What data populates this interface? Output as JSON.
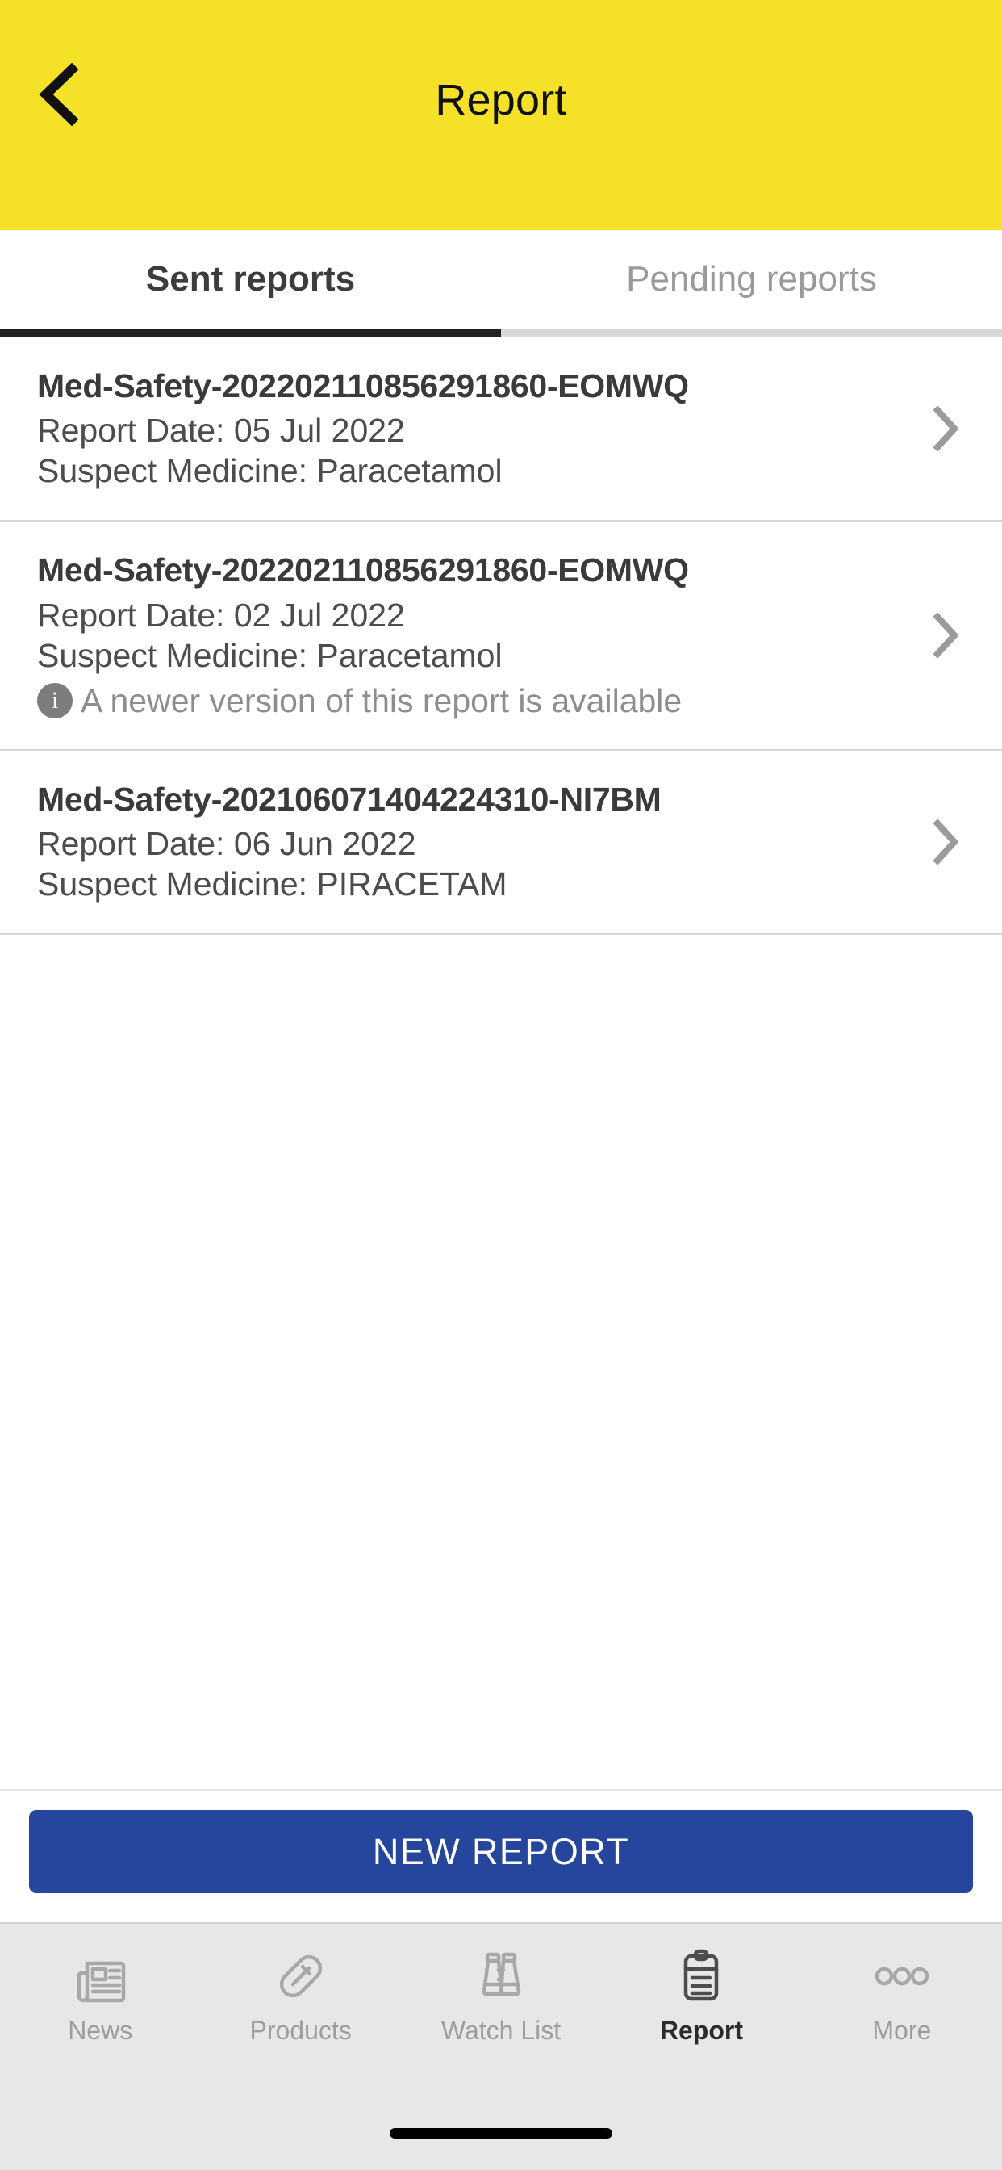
{
  "header": {
    "title": "Report",
    "back_icon": "chevron-left-icon",
    "background_color": "#F6E129"
  },
  "tabs": {
    "items": [
      {
        "label": "Sent reports",
        "active": true
      },
      {
        "label": "Pending reports",
        "active": false
      }
    ],
    "active_indicator_color": "#222222",
    "inactive_indicator_color": "#d8d8d8"
  },
  "reports": [
    {
      "id": "Med-Safety-202202110856291860-EOMWQ",
      "report_date": "Report Date: 05 Jul 2022",
      "suspect_medicine": "Suspect Medicine: Paracetamol",
      "note": "",
      "chevron_icon": "chevron-right-icon"
    },
    {
      "id": "Med-Safety-202202110856291860-EOMWQ",
      "report_date": "Report Date: 02 Jul 2022",
      "suspect_medicine": "Suspect Medicine: Paracetamol",
      "note": "A newer version of this report is available",
      "note_icon": "info-icon",
      "chevron_icon": "chevron-right-icon"
    },
    {
      "id": "Med-Safety-202106071404224310-NI7BM",
      "report_date": "Report Date: 06 Jun 2022",
      "suspect_medicine": "Suspect Medicine: PIRACETAM",
      "note": "",
      "chevron_icon": "chevron-right-icon"
    }
  ],
  "cta": {
    "label": "NEW REPORT",
    "color": "#26459c"
  },
  "bottom_nav": {
    "items": [
      {
        "label": "News",
        "icon": "newspaper-icon",
        "active": false
      },
      {
        "label": "Products",
        "icon": "pill-icon",
        "active": false
      },
      {
        "label": "Watch List",
        "icon": "binoculars-icon",
        "active": false
      },
      {
        "label": "Report",
        "icon": "clipboard-icon",
        "active": true
      },
      {
        "label": "More",
        "icon": "three-circles-icon",
        "active": false
      }
    ],
    "background_color": "#E7E7E7"
  }
}
